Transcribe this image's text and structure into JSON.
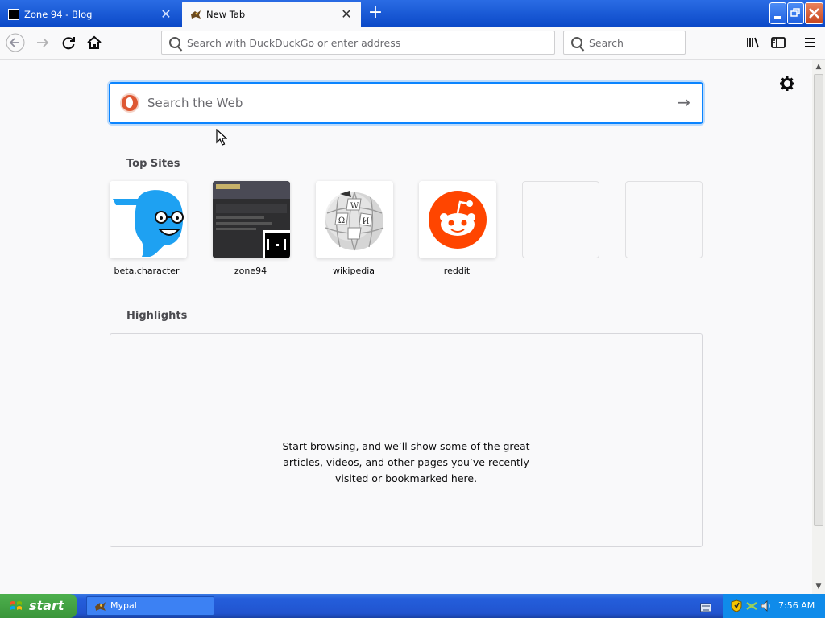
{
  "tabs": [
    {
      "title": "Zone 94 - Blog",
      "active": false,
      "icon": "zone94-favicon"
    },
    {
      "title": "New Tab",
      "active": true,
      "icon": "mypal-favicon"
    }
  ],
  "window_buttons": [
    "minimize",
    "maximize",
    "close"
  ],
  "navbar": {
    "url_placeholder": "Search with DuckDuckGo or enter address",
    "search_placeholder": "Search",
    "icons": [
      "back-icon",
      "forward-icon",
      "reload-icon",
      "home-icon",
      "library-icon",
      "sidebar-icon",
      "menu-icon"
    ]
  },
  "newtab": {
    "web_search_placeholder": "Search the Web",
    "search_engine_icon": "duckduckgo-icon",
    "top_sites_title": "Top Sites",
    "top_sites": [
      {
        "label": "beta.character",
        "icon": "beta-character-logo"
      },
      {
        "label": "zone94",
        "icon": "zone94-thumbnail"
      },
      {
        "label": "wikipedia",
        "icon": "wikipedia-globe"
      },
      {
        "label": "reddit",
        "icon": "reddit-logo"
      },
      {
        "label": "",
        "icon": "empty-tile"
      },
      {
        "label": "",
        "icon": "empty-tile"
      }
    ],
    "highlights_title": "Highlights",
    "highlights_message": "Start browsing, and we’ll show some of the great articles, videos, and other pages you’ve recently visited or bookmarked here."
  },
  "taskbar": {
    "start_label": "start",
    "tasks": [
      {
        "label": "Mypal",
        "icon": "mypal-icon"
      }
    ],
    "tray_icons": [
      "keyboard-icon",
      "security-shield-icon",
      "network-icon",
      "volume-icon"
    ],
    "clock": "7:56 AM"
  },
  "colors": {
    "accent": "#0a84ff",
    "titlebar": "#0b49c8",
    "reddit": "#ff4500",
    "beta_character": "#1ea1f2",
    "start_button": "#3a953a"
  }
}
